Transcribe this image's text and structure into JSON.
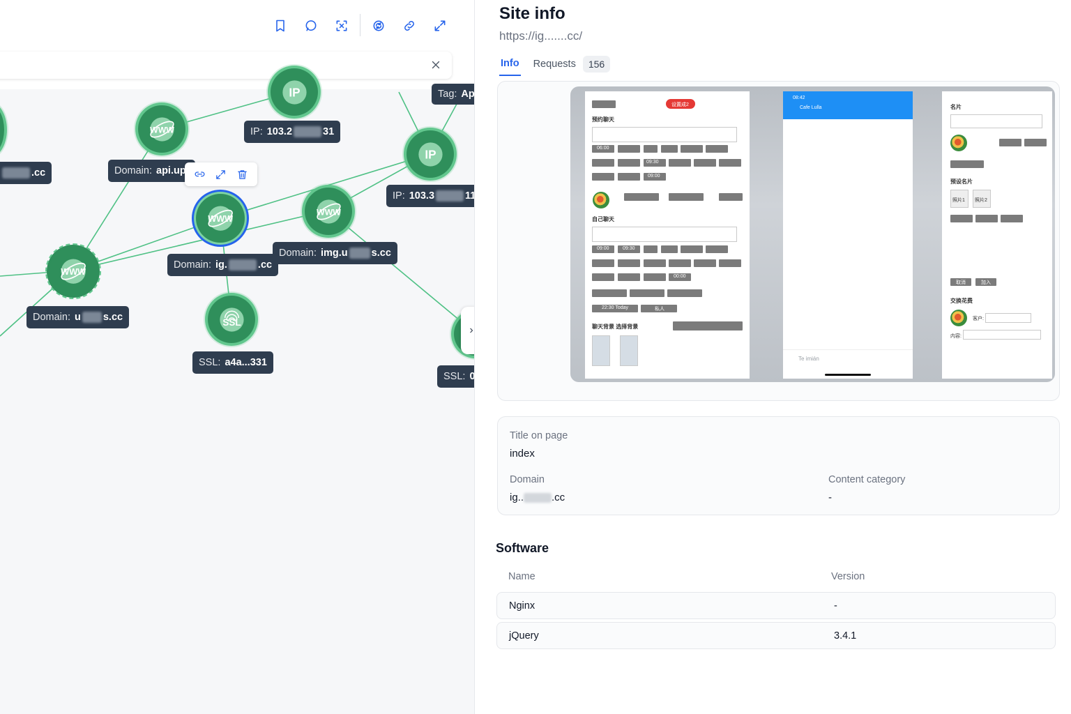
{
  "graph": {
    "search": {
      "value": "",
      "placeholder": ""
    },
    "nodes": {
      "domain_api": {
        "icon": "www-globe-icon",
        "label_key": "Domain:",
        "label_value_a": "api.upl",
        "label_value_b": ""
      },
      "domain_ig": {
        "icon": "www-globe-icon",
        "label_key": "Domain:",
        "label_value_a": "ig.",
        "label_value_b": ".cc"
      },
      "domain_img": {
        "icon": "www-globe-icon",
        "label_key": "Domain:",
        "label_value_a": "img.u",
        "label_value_b": "s.cc"
      },
      "domain_u": {
        "icon": "www-globe-icon",
        "label_key": "Domain:",
        "label_value_a": "u",
        "label_value_b": "s.cc"
      },
      "ip_top": {
        "icon": "ip-icon",
        "label_key": "IP:",
        "label_value_a": "103.2",
        "label_value_b": "31"
      },
      "ip_right": {
        "icon": "ip-icon",
        "label_key": "IP:",
        "label_value_a": "103.3",
        "label_value_b": "11"
      },
      "ssl_main": {
        "icon": "ssl-fingerprint-icon",
        "label_key": "SSL:",
        "label_value_a": "a4a...331"
      },
      "ssl_edge": {
        "icon": "ssl-fingerprint-icon",
        "label_key": "SSL:",
        "label_value_a": "0"
      },
      "tag_edge": {
        "label_key": "Tag:",
        "label_value_a": "Ap"
      },
      "left_edge_domain": {
        "label_value_b": ".cc"
      }
    },
    "node_icon_text": {
      "www": "WWW",
      "ip": "IP",
      "ssl": "SSL"
    },
    "collapse_handle": "›"
  },
  "detail": {
    "title": "Site info",
    "url": "https://ig.......cc/",
    "tabs": [
      {
        "label": "Info"
      },
      {
        "label": "Requests",
        "count": "156"
      }
    ],
    "screenshot": {
      "phone_a": {
        "section_1": "预约聊天",
        "section_2": "自己聊天",
        "times_row_1": [
          "06:00",
          "09:30",
          "09:00"
        ],
        "times_row_2": [
          "09:00",
          "09:30",
          "00:00"
        ],
        "today": "22:30 Today",
        "private": "私人",
        "bg_labels": "聊天背景   选择背景",
        "badge": "设置成2"
      },
      "phone_b": {
        "time": "08:42",
        "contact": "Cafe Lulla",
        "input_placeholder": "Te imián"
      },
      "phone_c": {
        "title": "名片",
        "preset_title": "预设名片",
        "photo_1": "照片1",
        "photo_2": "照片2",
        "exchange": "交换花费",
        "client": "客户:",
        "content": "内容:",
        "cancel": "取消",
        "join": "加入"
      }
    },
    "meta": {
      "title_label": "Title on page",
      "title_value": "index",
      "domain_label": "Domain",
      "domain_value_a": "ig..",
      "domain_value_b": ".cc",
      "category_label": "Content category",
      "category_value": "-"
    },
    "software": {
      "title": "Software",
      "col_name": "Name",
      "col_version": "Version",
      "rows": [
        {
          "name": "Nginx",
          "version": "-"
        },
        {
          "name": "jQuery",
          "version": "3.4.1"
        }
      ]
    }
  },
  "colors": {
    "accent": "#2563eb",
    "node_fill": "#2f8f5b",
    "node_ring": "#62c78e",
    "edge": "#4fc185",
    "tag_bg": "#2f3d4f"
  }
}
